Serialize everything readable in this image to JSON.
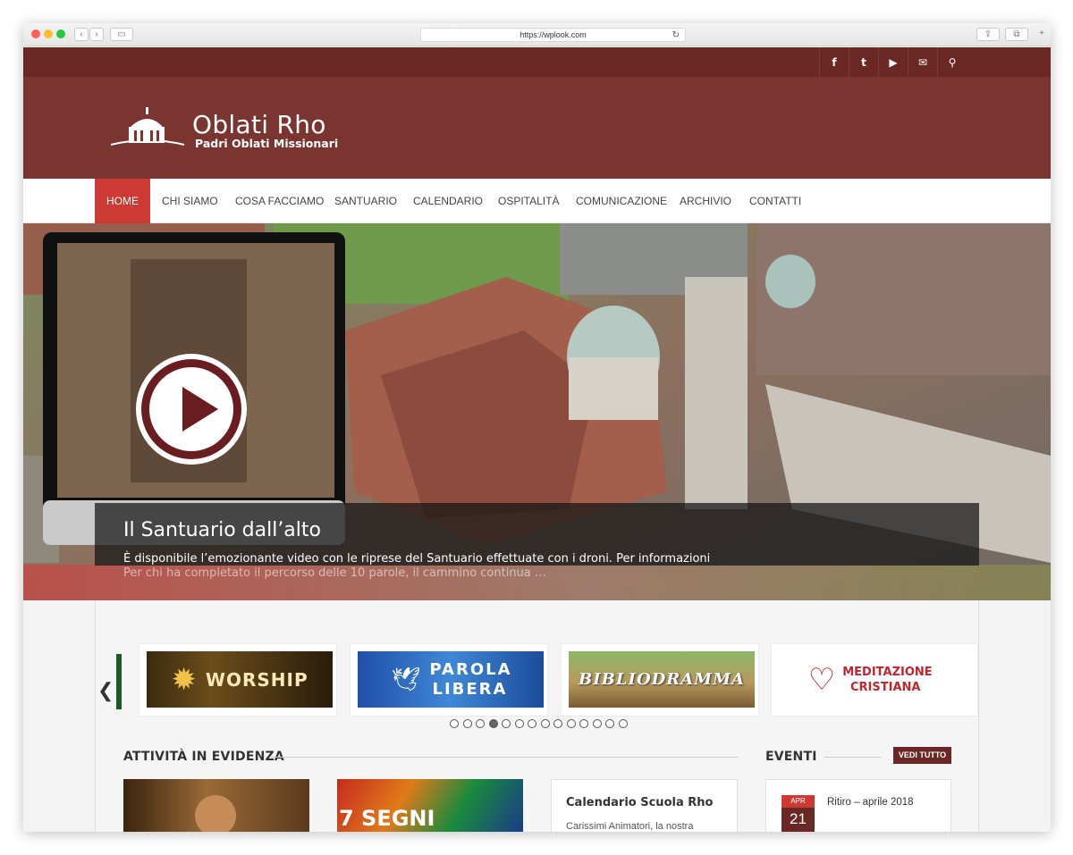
{
  "browser": {
    "url": "https://wplook.com"
  },
  "site": {
    "title": "Oblati Rho",
    "subtitle": "Padri Oblati Missionari",
    "brand_color": "#7b3531",
    "accent_color": "#cd3a33"
  },
  "social": [
    {
      "icon": "facebook-icon",
      "glyph": "f"
    },
    {
      "icon": "twitter-icon",
      "glyph": "t"
    },
    {
      "icon": "youtube-icon",
      "glyph": "▶"
    },
    {
      "icon": "mail-icon",
      "glyph": "✉"
    },
    {
      "icon": "search-icon",
      "glyph": "⚲"
    }
  ],
  "nav": {
    "items": [
      "HOME",
      "CHI SIAMO",
      "COSA FACCIAMO",
      "SANTUARIO",
      "CALENDARIO",
      "OSPITALITÀ",
      "COMUNICAZIONE",
      "ARCHIVIO",
      "CONTATTI"
    ],
    "active": "HOME"
  },
  "hero": {
    "title": "Il Santuario dall’alto",
    "text": "È disponibile l’emozionante video con le riprese del Santuario effettuate con i droni. Per informazioni",
    "next_text": "Per chi ha completato il percorso delle 10 parole, il cammino continua …"
  },
  "carousel": {
    "banners": [
      "WORSHIP",
      "PAROLA LIBERA",
      "BIBLIODRAMMA",
      "MEDITAZIONE CRISTIANA"
    ],
    "pages": 14,
    "active_page": 4
  },
  "activities": {
    "heading": "ATTIVITÀ IN EVIDENZA",
    "segni_label": "7 SEGNI",
    "post_title": "Calendario Scuola Rho",
    "post_excerpt": "Carissimi Animatori, la nostra"
  },
  "events": {
    "heading": "EVENTI",
    "see_all": "VEDI TUTTO",
    "items": [
      {
        "month": "APR",
        "day": "21",
        "title": "Ritiro – aprile 2018"
      }
    ]
  }
}
